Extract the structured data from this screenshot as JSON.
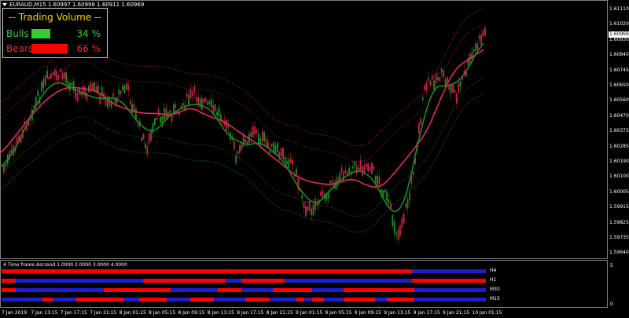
{
  "chart": {
    "symbol_line": "EURAUD,M15  1.60997 1.60998 1.60911 1.60969",
    "current_price": "1.60969"
  },
  "trading_volume": {
    "title": "-- Trading Volume --",
    "bulls": {
      "label": "Bulls",
      "percent": "34 %",
      "value": 34,
      "color": "#32cd32"
    },
    "bears": {
      "label": "Bears",
      "percent": "66 %",
      "value": 66,
      "color": "#ff0000"
    }
  },
  "price_axis": [
    "1.61110",
    "1.61020",
    "1.60930",
    "1.60840",
    "1.60745",
    "1.60650",
    "1.60560",
    "1.60470",
    "1.60375",
    "1.60285",
    "1.60190",
    "1.60100",
    "1.60005",
    "1.59915",
    "1.59825",
    "1.59735",
    "1.59640"
  ],
  "time_axis": [
    "7 Jan 2019",
    "7 Jan 13:15",
    "7 Jan 17:15",
    "7 Jan 21:15",
    "8 Jan 01:15",
    "8 Jan 05:15",
    "8 Jan 09:15",
    "8 Jan 13:15",
    "8 Jan 17:15",
    "8 Jan 21:15",
    "9 Jan 01:15",
    "9 Jan 05:15",
    "9 Jan 09:15",
    "9 Jan 13:15",
    "9 Jan 17:15",
    "9 Jan 21:15",
    "10 Jan 01:15"
  ],
  "indicator": {
    "title": "4 Time frame Ascrend 1.0000 2.0000 3.0000 4.0000",
    "scale_top": "5",
    "scale_bottom": "0",
    "timeframes": [
      "H4",
      "H1",
      "M30",
      "M15"
    ]
  },
  "colors": {
    "up": "#ff0000",
    "down": "#1e1ecc",
    "bull_line": "#1e8c1e",
    "bear_line": "#e8285a"
  }
}
